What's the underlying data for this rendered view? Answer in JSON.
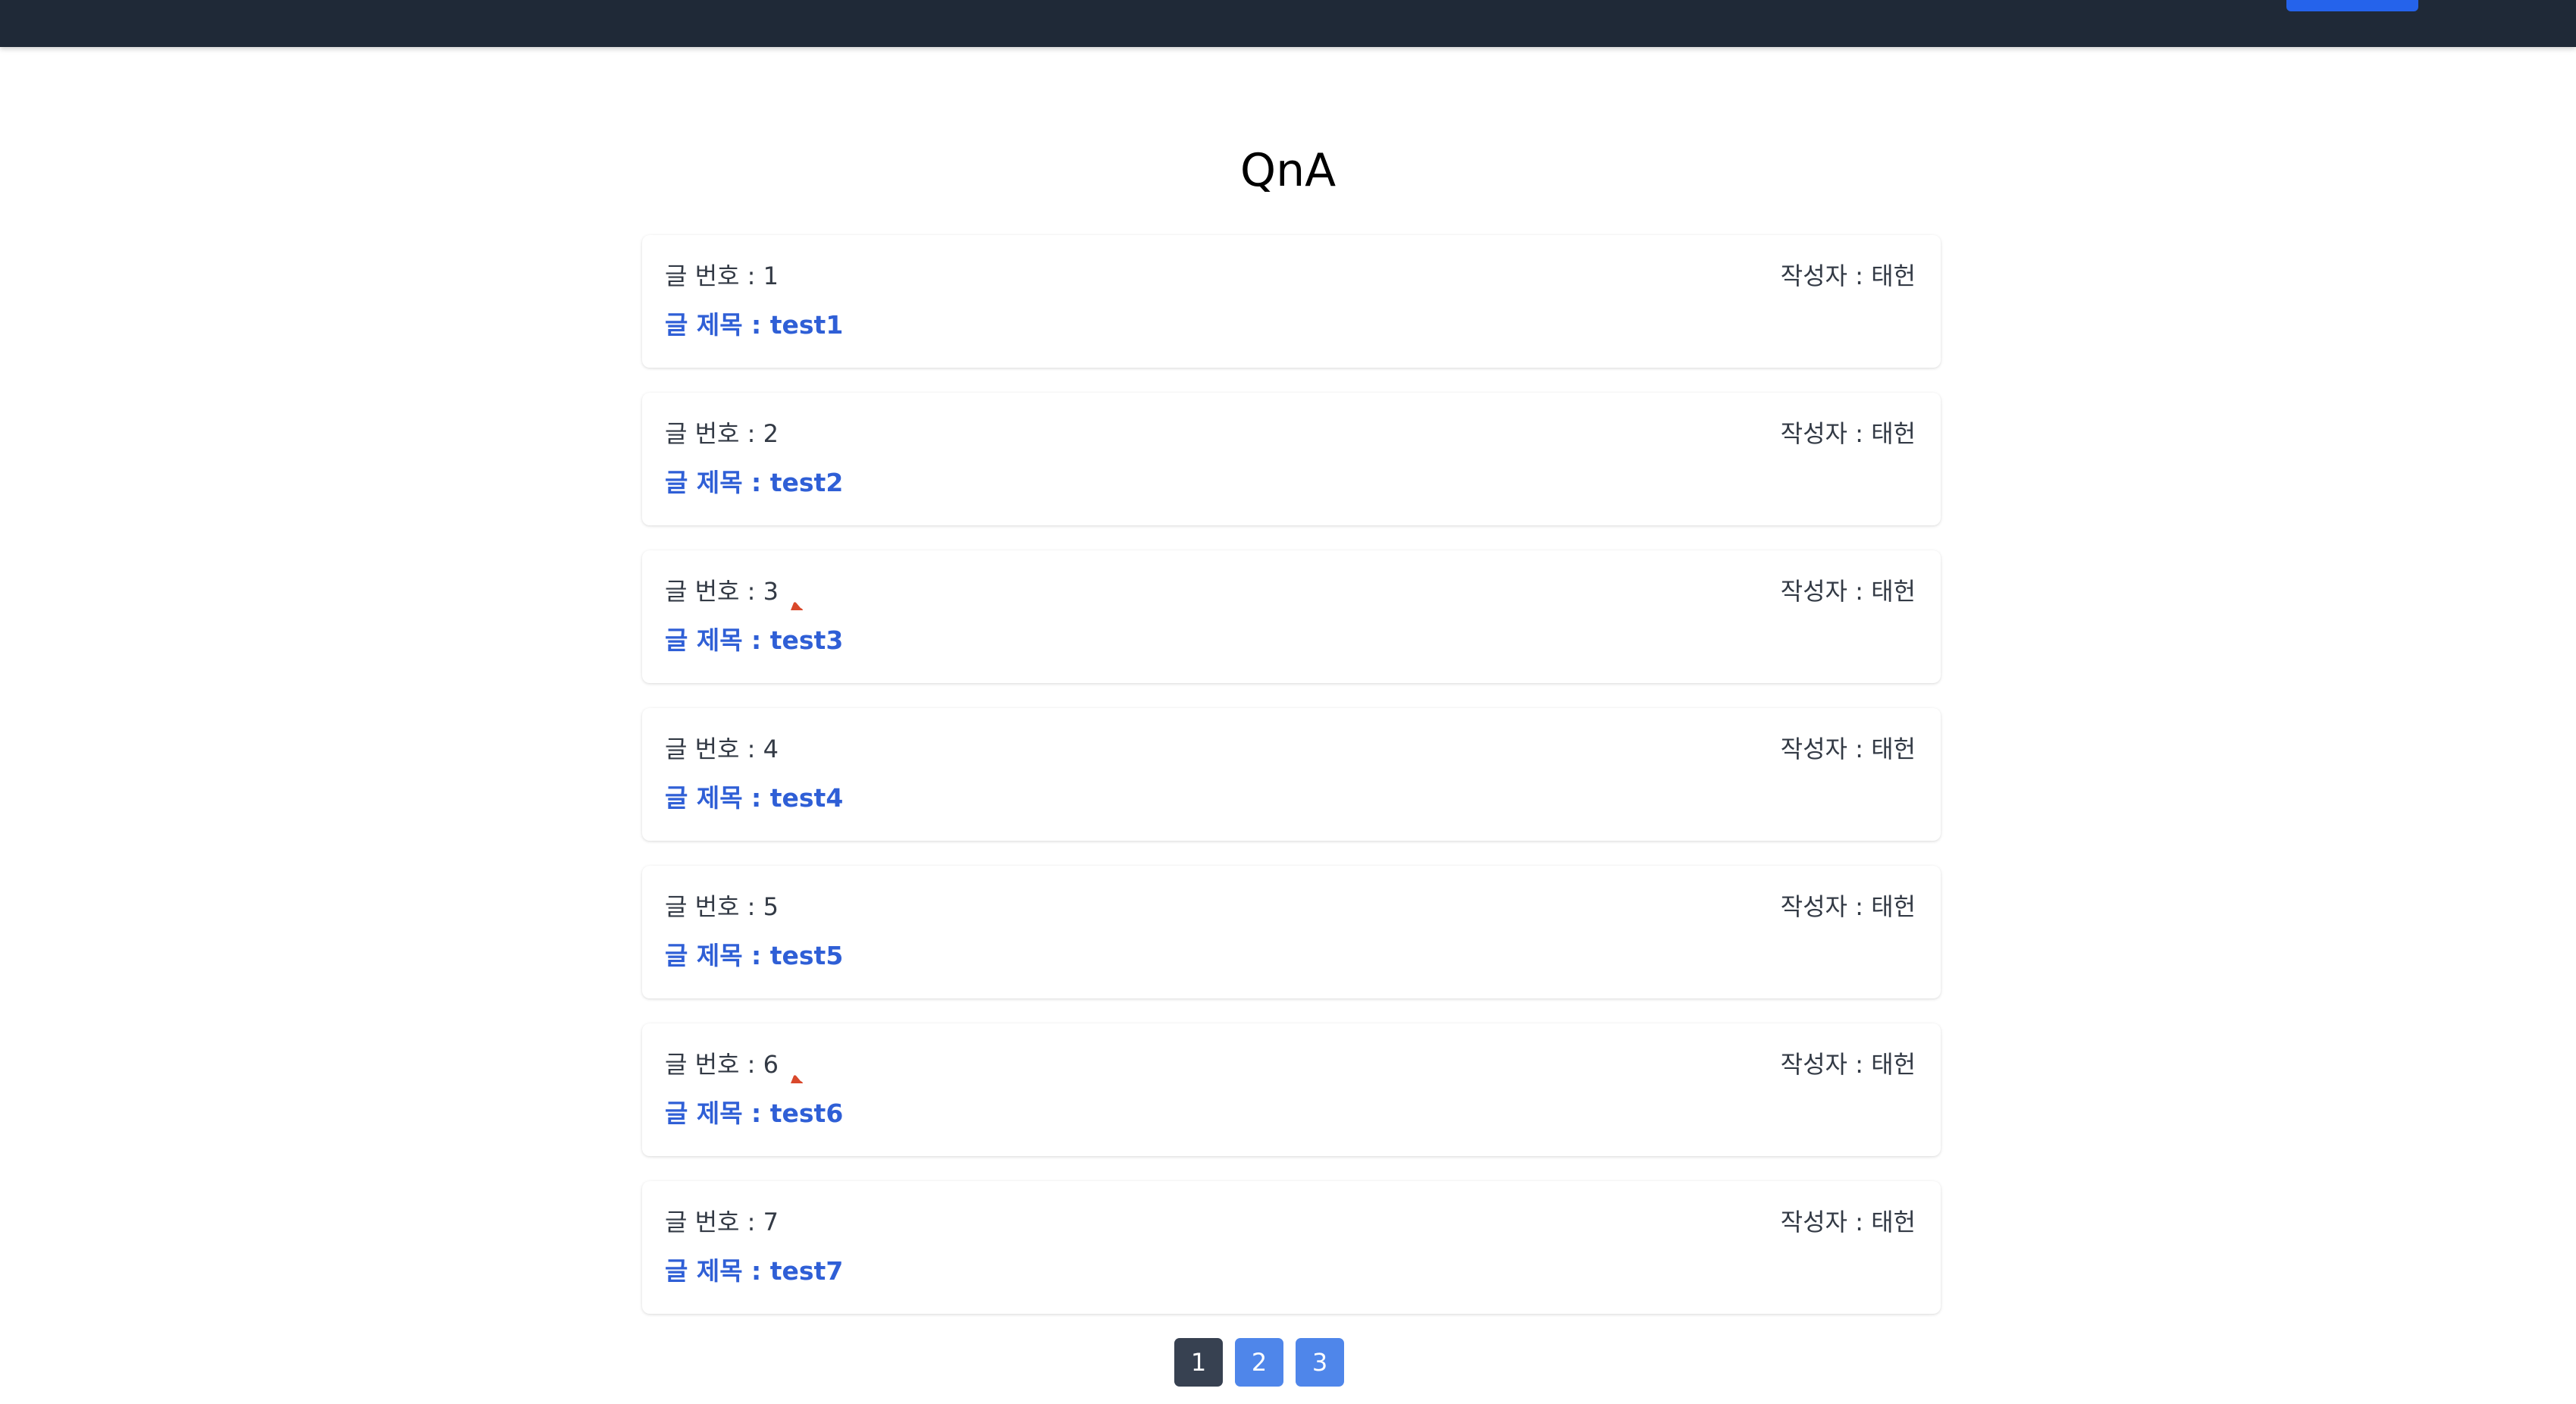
{
  "header": {
    "button_label": ""
  },
  "page": {
    "title": "QnA"
  },
  "posts": [
    {
      "number_text": "글 번호 : 1",
      "author_text": "작성자 : 태헌",
      "title_text": "글 제목 : test1",
      "locked": false
    },
    {
      "number_text": "글 번호 : 2",
      "author_text": "작성자 : 태헌",
      "title_text": "글 제목 : test2",
      "locked": false
    },
    {
      "number_text": "글 번호 : 3",
      "author_text": "작성자 : 태헌",
      "title_text": "글 제목 : test3",
      "locked": true
    },
    {
      "number_text": "글 번호 : 4",
      "author_text": "작성자 : 태헌",
      "title_text": "글 제목 : test4",
      "locked": false
    },
    {
      "number_text": "글 번호 : 5",
      "author_text": "작성자 : 태헌",
      "title_text": "글 제목 : test5",
      "locked": false
    },
    {
      "number_text": "글 번호 : 6",
      "author_text": "작성자 : 태헌",
      "title_text": "글 제목 : test6",
      "locked": true
    },
    {
      "number_text": "글 번호 : 7",
      "author_text": "작성자 : 태헌",
      "title_text": "글 제목 : test7",
      "locked": false
    }
  ],
  "pagination": {
    "pages": [
      "1",
      "2",
      "3"
    ],
    "current": "1"
  },
  "icons": {
    "lock": "lock-icon"
  },
  "colors": {
    "header_bg": "#1f2937",
    "accent": "#2563eb",
    "title_link": "#2f5fd6",
    "page_active": "#374151",
    "page_inactive": "#4f86ea",
    "lock_icon": "#d9482b"
  }
}
